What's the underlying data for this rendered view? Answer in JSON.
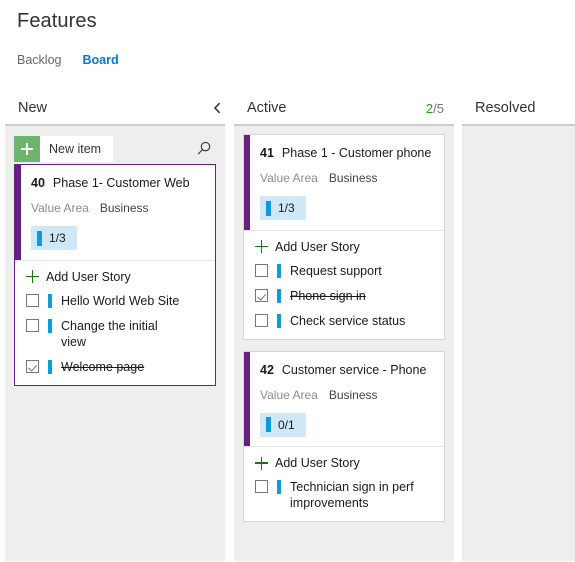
{
  "page": {
    "title": "Features"
  },
  "tabs": [
    {
      "label": "Backlog",
      "selected": false
    },
    {
      "label": "Board",
      "selected": true
    }
  ],
  "toolbar": {
    "new_item_label": "New item",
    "search_icon": "search-icon"
  },
  "columns": [
    {
      "id": "new",
      "title": "New",
      "count_current": "",
      "count_limit": "",
      "collapse_icon": "chevron-left-icon",
      "has_toolbar": true,
      "cards": [
        {
          "id": "40",
          "title": "Phase 1- Customer Web",
          "selected": true,
          "field_label": "Value Area",
          "field_value": "Business",
          "progress": "1/3",
          "add_label": "Add User Story",
          "checklist": [
            {
              "text": "Hello World Web Site",
              "checked": false
            },
            {
              "text": "Change the initial view",
              "checked": false
            },
            {
              "text": "Welcome page",
              "checked": true
            }
          ]
        }
      ]
    },
    {
      "id": "active",
      "title": "Active",
      "count_current": "2",
      "count_limit": "/5",
      "collapse_icon": "",
      "has_toolbar": false,
      "cards": [
        {
          "id": "41",
          "title": "Phase 1 - Customer phone",
          "selected": false,
          "field_label": "Value Area",
          "field_value": "Business",
          "progress": "1/3",
          "add_label": "Add User Story",
          "checklist": [
            {
              "text": "Request support",
              "checked": false
            },
            {
              "text": "Phone sign in",
              "checked": true
            },
            {
              "text": "Check service status",
              "checked": false
            }
          ]
        },
        {
          "id": "42",
          "title": "Customer service - Phone",
          "selected": false,
          "field_label": "Value Area",
          "field_value": "Business",
          "progress": "0/1",
          "add_label": "Add User Story",
          "checklist": [
            {
              "text": "Technician sign in perf improvements",
              "checked": false
            }
          ]
        }
      ]
    },
    {
      "id": "resolved",
      "title": "Resolved",
      "count_current": "",
      "count_limit": "",
      "collapse_icon": "",
      "has_toolbar": false,
      "cards": []
    }
  ],
  "colors": {
    "card_accent": "#68217a",
    "progress_bar": "#0e9bdb",
    "progress_bg": "#cfe7f7",
    "add_green": "#107c10",
    "new_item_green": "#6cb56c",
    "tab_selected": "#0078d4",
    "count_ok": "#1f9e1f",
    "column_bg": "#eeeeee"
  }
}
